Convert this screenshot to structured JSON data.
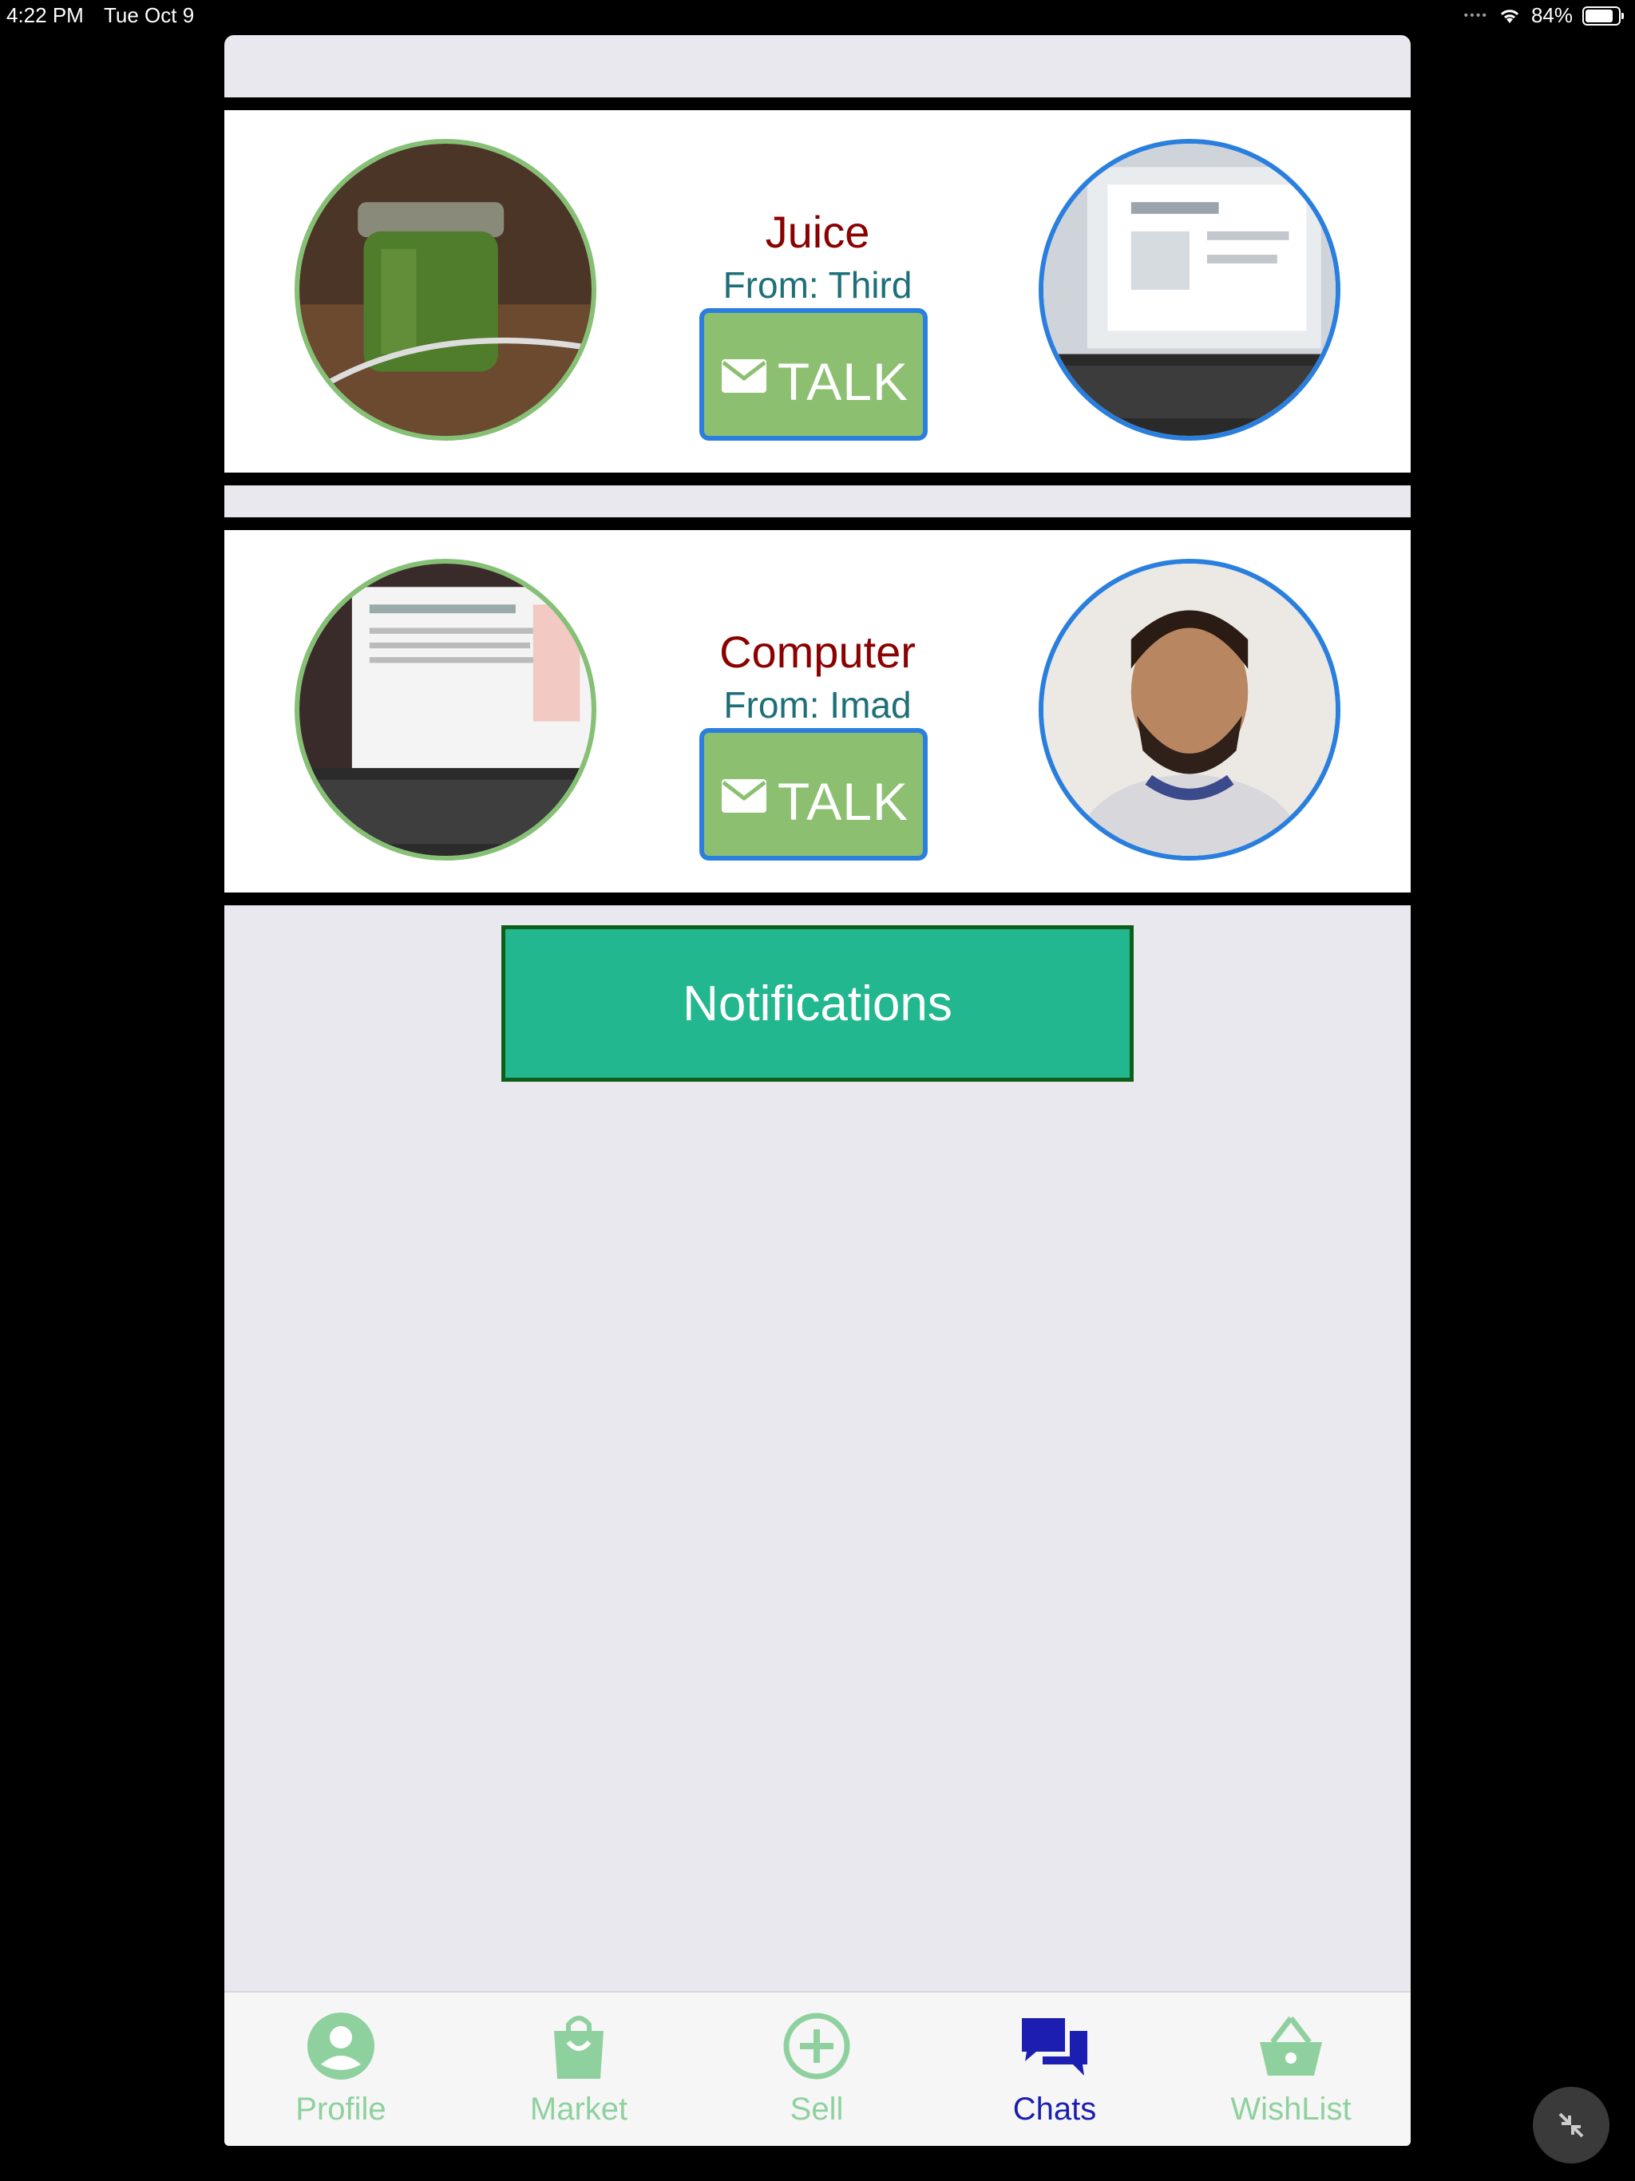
{
  "status_bar": {
    "time": "4:22 PM",
    "date": "Tue Oct 9",
    "battery": "84%"
  },
  "colors": {
    "title": "#8b0000",
    "from": "#1d6f78",
    "talk_bg": "#8cc070",
    "talk_border": "#2a7fde",
    "notif_bg": "#22b78f",
    "tab_inactive": "#8fd19e",
    "tab_active": "#1b1eb0"
  },
  "chats": [
    {
      "item": "Juice",
      "from": "From: Third",
      "talk_label": "TALK",
      "item_photo": "juice-jar-photo",
      "user_photo": "laptop-screen-photo"
    },
    {
      "item": "Computer",
      "from": "From: Imad",
      "talk_label": "TALK",
      "item_photo": "laptop-document-photo",
      "user_photo": "man-portrait-photo"
    }
  ],
  "notifications_label": "Notifications",
  "tabs": [
    {
      "label": "Profile",
      "icon": "person-circle-icon",
      "active": false
    },
    {
      "label": "Market",
      "icon": "shopping-bag-icon",
      "active": false
    },
    {
      "label": "Sell",
      "icon": "plus-circle-icon",
      "active": false
    },
    {
      "label": "Chats",
      "icon": "chat-bubbles-icon",
      "active": true
    },
    {
      "label": "WishList",
      "icon": "basket-icon",
      "active": false
    }
  ]
}
